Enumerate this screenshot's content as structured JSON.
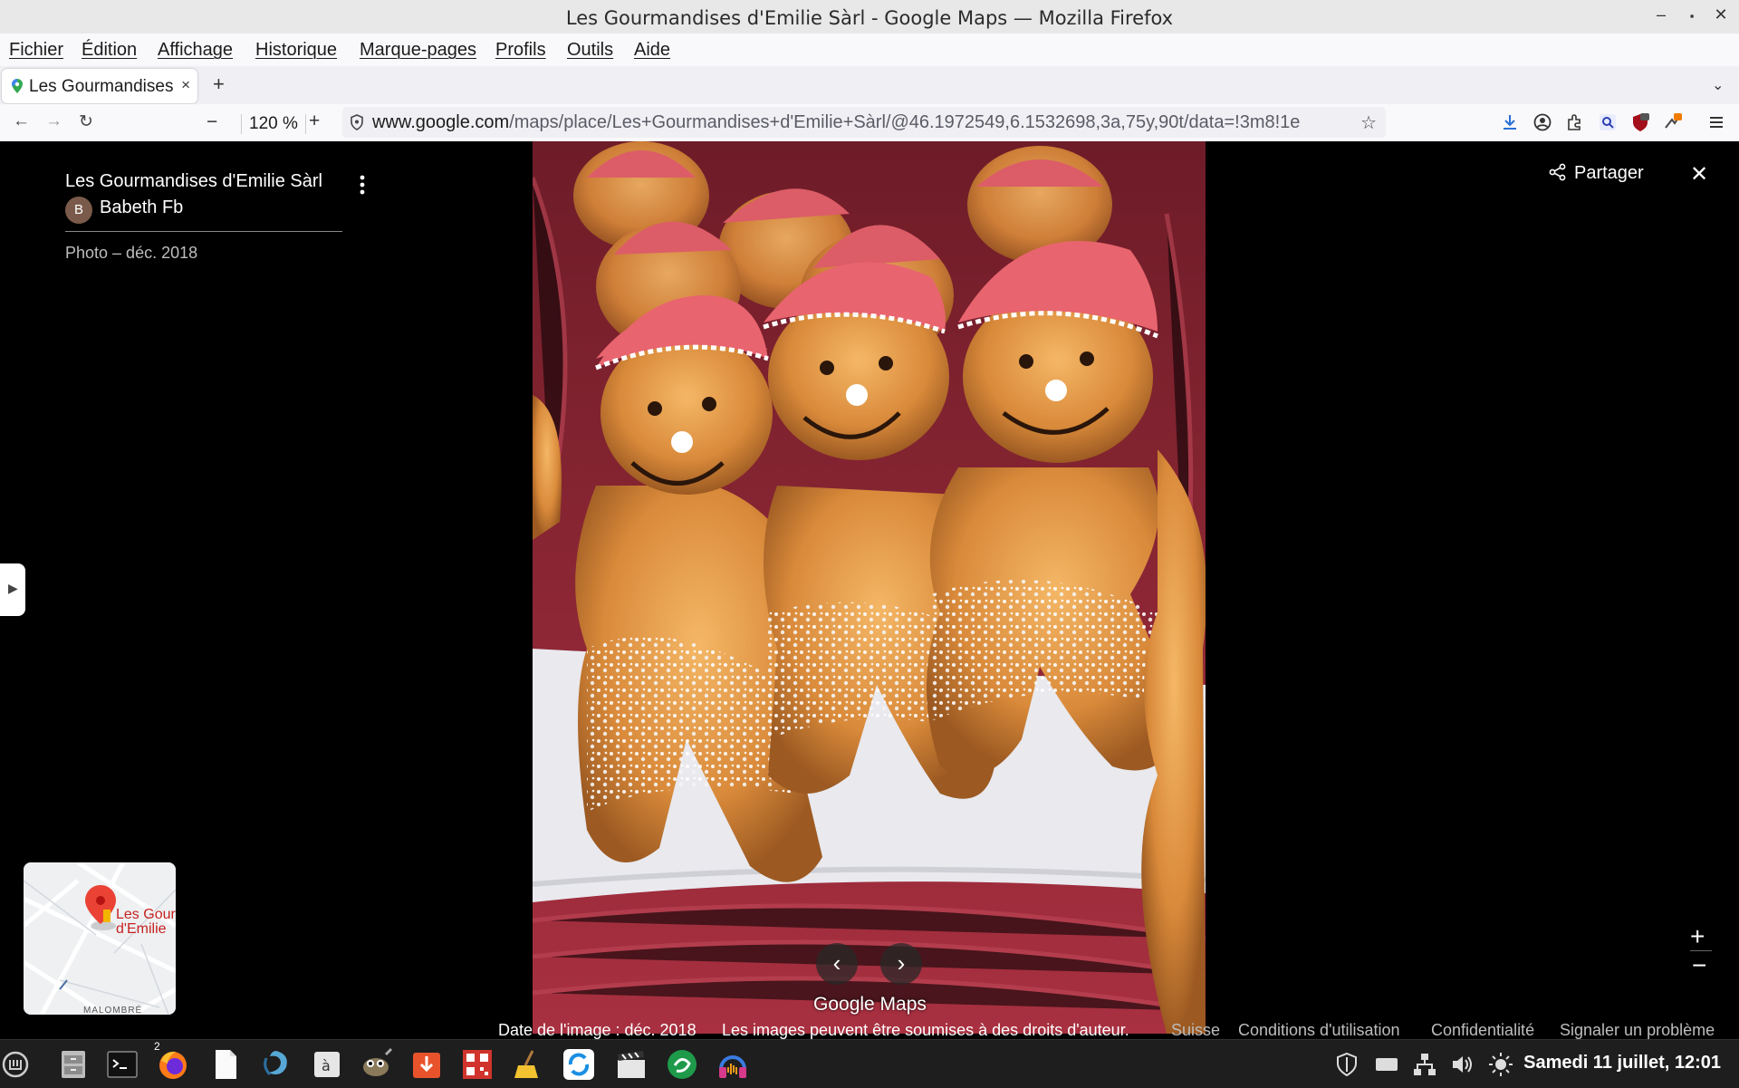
{
  "window": {
    "title": "Les Gourmandises d'Emilie Sàrl - Google Maps — Mozilla Firefox"
  },
  "menubar": {
    "items": [
      "Fichier",
      "Édition",
      "Affichage",
      "Historique",
      "Marque-pages",
      "Profils",
      "Outils",
      "Aide"
    ]
  },
  "tab": {
    "title": "Les Gourmandises d'Emilie Sàrl",
    "close": "×",
    "new_tab": "+"
  },
  "nav": {
    "zoom_minus": "−",
    "zoom_level": "120 %",
    "zoom_plus": "+",
    "url_host": "www.google.com",
    "url_path": "/maps/place/Les+Gourmandises+d'Emilie+Sàrl/@46.1972549,6.1532698,3a,75y,90t/data=!3m8!1e"
  },
  "panel": {
    "place_name": "Les Gourmandises d'Emilie Sàrl",
    "author_initial": "B",
    "author": "Babeth Fb",
    "photo_date": "Photo – déc. 2018"
  },
  "photo_viewer": {
    "share_label": "Partager",
    "close": "✕",
    "prev": "‹",
    "next": "›",
    "logo": "Google Maps",
    "zoom_in": "+",
    "zoom_out": "−"
  },
  "minimap": {
    "label_line1": "Les Gour",
    "label_line2": "d'Emilie",
    "district": "MALOMBRÉ"
  },
  "footer": {
    "image_date": "Date de l'image : déc. 2018",
    "copyright": "Les images peuvent être soumises à des droits d'auteur.",
    "country": "Suisse",
    "terms": "Conditions d'utilisation",
    "privacy": "Confidentialité",
    "report": "Signaler un problème"
  },
  "taskbar": {
    "clock": "Samedi 11 juillet, 12:01",
    "terminal_badge": "2"
  },
  "colors": {
    "accent_red": "#ea4335",
    "hat_pink": "#e8646e",
    "bread": "#d98a3a",
    "basket": "#8a2030"
  }
}
